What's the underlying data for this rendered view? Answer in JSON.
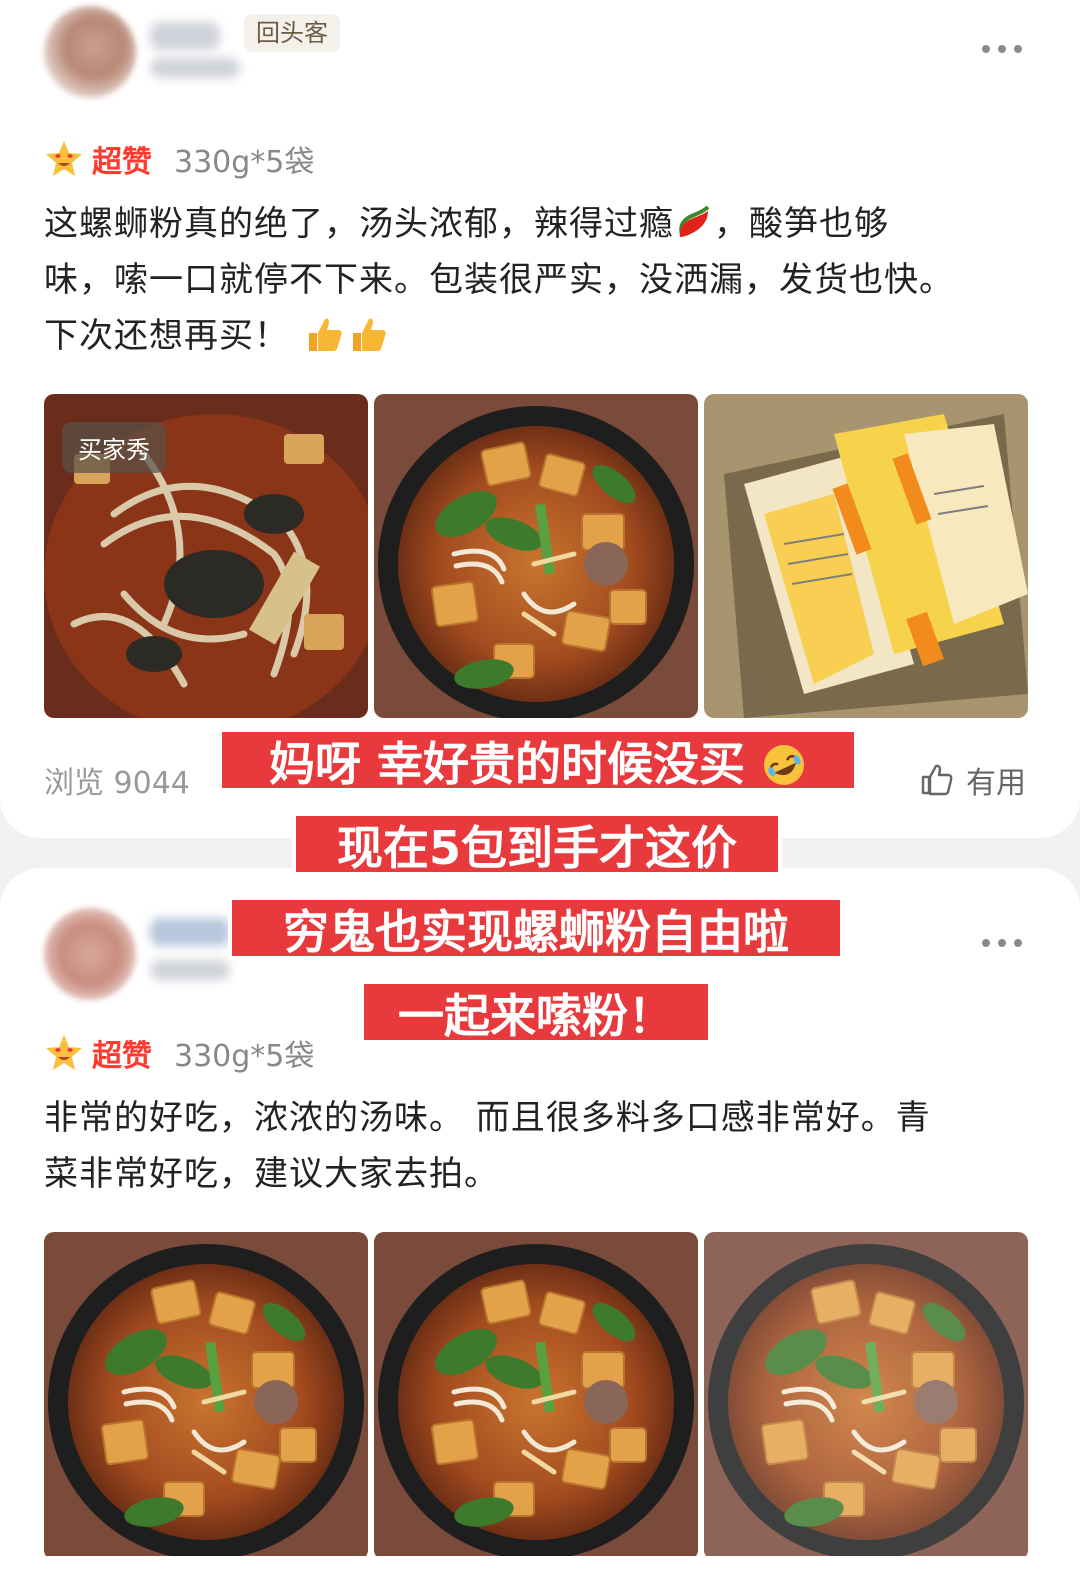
{
  "reviews": [
    {
      "badge": "回头客",
      "rating_label": "超赞",
      "spec": "330g*5袋",
      "text_line1": "这螺蛳粉真的绝了，汤头浓郁，辣得过瘾",
      "text_line1_tail": "，酸笋也够",
      "text_line2": "味，嗦一口就停不下来。包装很严实，没洒漏，发货也快。",
      "text_line3": "下次还想再买！",
      "photo_label": "买家秀",
      "views": "浏览 9044",
      "useful_label": "有用"
    },
    {
      "rating_label": "超赞",
      "spec": "330g*5袋",
      "text_line1": "非常的好吃，浓浓的汤味。 而且很多料多口感非常好。青",
      "text_line2": "菜非常好吃，建议大家去拍。"
    }
  ],
  "banners": [
    "妈呀 幸好贵的时候没买",
    "现在5包到手才这价",
    "穷鬼也实现螺蛳粉自由啦",
    "一起来嗦粉！"
  ],
  "icons": {
    "star": "star-face-icon",
    "more": "more-dots-icon",
    "thumb": "thumbs-up-icon",
    "chili": "chili-pepper-icon",
    "laugh": "rofl-emoji-icon"
  },
  "colors": {
    "accent_red": "#ff3b30",
    "banner_red": "#e83a3c"
  }
}
